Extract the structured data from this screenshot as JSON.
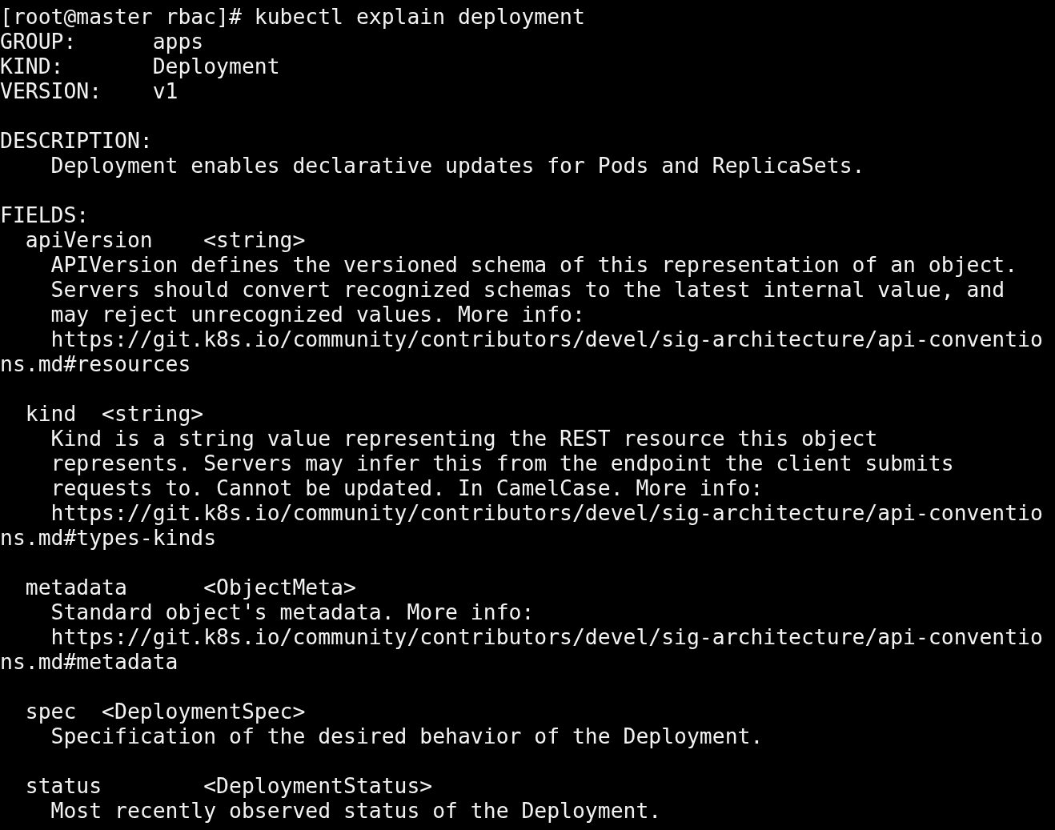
{
  "terminal": {
    "blocks": [
      [
        "[root@master rbac]# kubectl explain deployment",
        "GROUP:      apps",
        "KIND:       Deployment",
        "VERSION:    v1"
      ],
      [
        "DESCRIPTION:",
        "    Deployment enables declarative updates for Pods and ReplicaSets."
      ],
      [
        "FIELDS:",
        "  apiVersion    <string>",
        "    APIVersion defines the versioned schema of this representation of an object.",
        "    Servers should convert recognized schemas to the latest internal value, and",
        "    may reject unrecognized values. More info:",
        "    https://git.k8s.io/community/contributors/devel/sig-architecture/api-conventio",
        "ns.md#resources"
      ],
      [
        "  kind  <string>",
        "    Kind is a string value representing the REST resource this object",
        "    represents. Servers may infer this from the endpoint the client submits",
        "    requests to. Cannot be updated. In CamelCase. More info:",
        "    https://git.k8s.io/community/contributors/devel/sig-architecture/api-conventio",
        "ns.md#types-kinds"
      ],
      [
        "  metadata      <ObjectMeta>",
        "    Standard object's metadata. More info:",
        "    https://git.k8s.io/community/contributors/devel/sig-architecture/api-conventio",
        "ns.md#metadata"
      ],
      [
        "  spec  <DeploymentSpec>",
        "    Specification of the desired behavior of the Deployment."
      ],
      [
        "  status        <DeploymentStatus>",
        "    Most recently observed status of the Deployment."
      ]
    ]
  }
}
